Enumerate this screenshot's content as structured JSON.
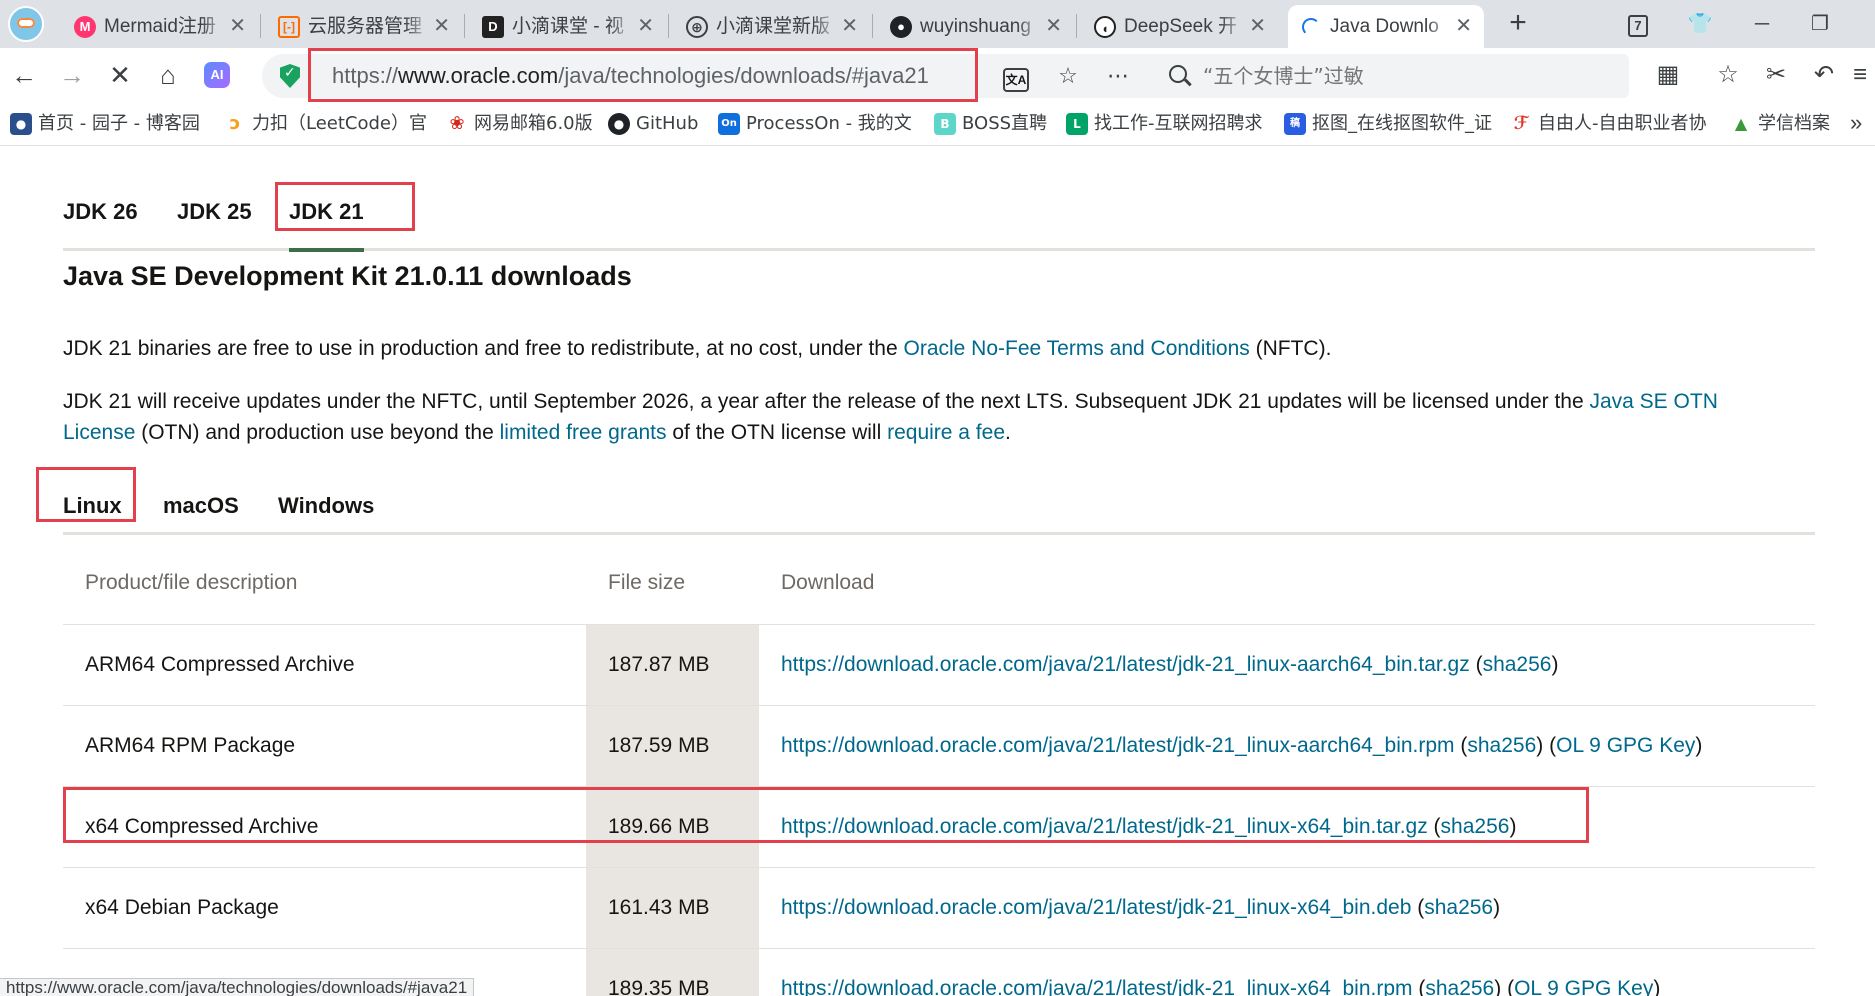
{
  "browser": {
    "tabs": [
      {
        "title": "Mermaid注册",
        "icon": "mermaid-icon"
      },
      {
        "title": "云服务器管理",
        "icon": "cloud-icon"
      },
      {
        "title": "小滴课堂 - 视",
        "icon": "xiaodi-icon"
      },
      {
        "title": "小滴课堂新版",
        "icon": "globe-icon"
      },
      {
        "title": "wuyinshuang",
        "icon": "github-icon"
      },
      {
        "title": "DeepSeek 开",
        "icon": "deepseek-icon"
      },
      {
        "title": "Java Downlo",
        "icon": "loading-icon",
        "active": true
      }
    ],
    "tab_count_badge": "7",
    "address_bar": {
      "scheme": "https://",
      "host": "www.oracle.com",
      "path": "/java/technologies/downloads/#java21"
    },
    "search_placeholder": "“五个女博士”过敏",
    "bookmarks": [
      {
        "label": "首页 - 园子 - 博客园",
        "icon": "cnblogs-icon"
      },
      {
        "label": "力扣（LeetCode）官",
        "icon": "leetcode-icon"
      },
      {
        "label": "网易邮箱6.0版",
        "icon": "netease-mail-icon"
      },
      {
        "label": "GitHub",
        "icon": "github-icon"
      },
      {
        "label": "ProcessOn - 我的文",
        "icon": "processon-icon"
      },
      {
        "label": "BOSS直聘",
        "icon": "boss-icon"
      },
      {
        "label": "找工作-互联网招聘求",
        "icon": "lagou-icon"
      },
      {
        "label": "抠图_在线抠图软件_证",
        "icon": "koutu-icon"
      },
      {
        "label": "自由人-自由职业者协",
        "icon": "ziyouren-icon"
      },
      {
        "label": "学信档案",
        "icon": "xuexin-icon"
      }
    ],
    "status_url": "https://www.oracle.com/java/technologies/downloads/#java21"
  },
  "page": {
    "jdk_tabs": [
      "JDK 26",
      "JDK 25",
      "JDK 21"
    ],
    "active_jdk_tab": "JDK 21",
    "title": "Java SE Development Kit 21.0.11 downloads",
    "para1": {
      "before": "JDK 21 binaries are free to use in production and free to redistribute, at no cost, under the ",
      "link": "Oracle No-Fee Terms and Conditions",
      "after": " (NFTC)."
    },
    "para2": {
      "t1": "JDK 21 will receive updates under the NFTC, until September 2026, a year after the release of the next LTS. Subsequent JDK 21 updates will be licensed under the ",
      "link1": "Java SE OTN License",
      "t2": " (OTN) and production use beyond the ",
      "link2": "limited free grants",
      "t3": " of the OTN license will ",
      "link3": "require a fee",
      "t4": "."
    },
    "os_tabs": [
      "Linux",
      "macOS",
      "Windows"
    ],
    "active_os_tab": "Linux",
    "table": {
      "headers": [
        "Product/file description",
        "File size",
        "Download"
      ],
      "rows": [
        {
          "desc": "ARM64 Compressed Archive",
          "size": "187.87 MB",
          "url": "https://download.oracle.com/java/21/latest/jdk-21_linux-aarch64_bin.tar.gz",
          "sha": "sha256",
          "gpg": ""
        },
        {
          "desc": "ARM64 RPM Package",
          "size": "187.59 MB",
          "url": "https://download.oracle.com/java/21/latest/jdk-21_linux-aarch64_bin.rpm",
          "sha": "sha256",
          "gpg": "OL 9 GPG Key"
        },
        {
          "desc": "x64 Compressed Archive",
          "size": "189.66 MB",
          "url": "https://download.oracle.com/java/21/latest/jdk-21_linux-x64_bin.tar.gz",
          "sha": "sha256",
          "gpg": ""
        },
        {
          "desc": "x64 Debian Package",
          "size": "161.43 MB",
          "url": "https://download.oracle.com/java/21/latest/jdk-21_linux-x64_bin.deb",
          "sha": "sha256",
          "gpg": ""
        },
        {
          "desc": "",
          "size": "189.35 MB",
          "url": "https://download.oracle.com/java/21/latest/jdk-21_linux-x64_bin.rpm",
          "sha": "sha256",
          "gpg": "OL 9 GPG Key"
        }
      ]
    }
  },
  "colors": {
    "link": "#00688c",
    "highlight_box": "#e3404d",
    "active_tab_underline": "#3e6d4a",
    "filesize_column_bg": "#e9e6e2"
  }
}
